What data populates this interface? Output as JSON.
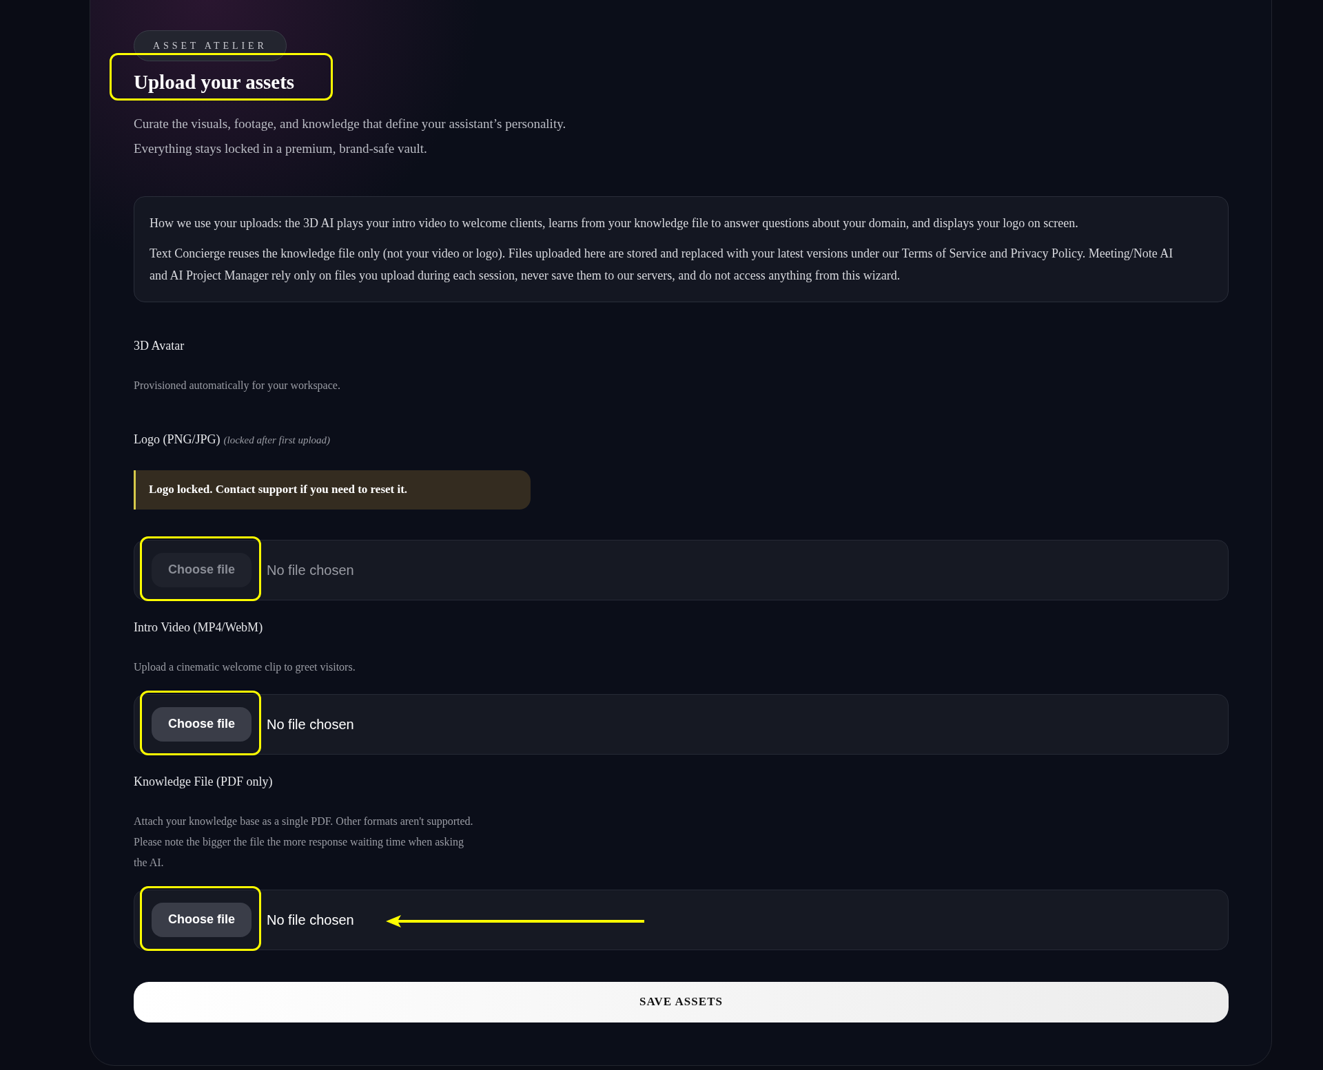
{
  "badge": "ASSET ATELIER",
  "heading": {
    "text": "Upload your assets",
    "highlighted": true
  },
  "intro": [
    "Curate the visuals, footage, and knowledge that define your assistant’s personality.",
    "Everything stays locked in a premium, brand-safe vault."
  ],
  "info": [
    "How we use your uploads: the 3D AI plays your intro video to welcome clients, learns from your knowledge file to answer questions about your domain, and displays your logo on screen.",
    "Text Concierge reuses the knowledge file only (not your video or logo). Files uploaded here are stored and replaced with your latest versions under our Terms of Service and Privacy Policy. Meeting/Note AI and AI Project Manager rely only on files you upload during each session, never save them to our servers, and do not access anything from this wizard."
  ],
  "sections": [
    {
      "label": "3D Avatar",
      "description": [
        "Provisioned automatically for your workspace."
      ]
    },
    {
      "label": "Logo (PNG/JPG)",
      "note": "(locked after first upload)",
      "warning": "Logo locked. Contact support if you need to reset it.",
      "upload": {
        "button": "Choose file",
        "status": "No file chosen",
        "disabled": true,
        "highlighted": true,
        "arrow": false
      }
    },
    {
      "label": "Intro Video (MP4/WebM)",
      "description": [
        "Upload a cinematic welcome clip to greet visitors."
      ],
      "upload": {
        "button": "Choose file",
        "status": "No file chosen",
        "disabled": false,
        "highlighted": true,
        "arrow": false
      }
    },
    {
      "label": "Knowledge File (PDF only)",
      "description": [
        "Attach your knowledge base as a single PDF. Other formats aren't supported.",
        "Please note the bigger the file the more response waiting time when asking",
        "the AI."
      ],
      "upload": {
        "button": "Choose file",
        "status": "No file chosen",
        "disabled": false,
        "highlighted": true,
        "arrow": true
      }
    }
  ],
  "save_button": "SAVE ASSETS"
}
